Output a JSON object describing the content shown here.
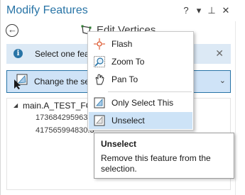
{
  "pane": {
    "title": "Modify Features",
    "controls": {
      "help": "?",
      "menu": "▾",
      "pin": "⊥",
      "close": "✕"
    }
  },
  "tool": {
    "label": "Edit Vertices"
  },
  "info": {
    "text": "Select one feat"
  },
  "change_selection": {
    "label": "Change the se"
  },
  "tree": {
    "root_label": "main.A_TEST_FC_3",
    "children": [
      "173684295963.",
      "417565994830.3"
    ]
  },
  "context_menu": {
    "items": [
      {
        "label": "Flash",
        "icon": "flash-icon"
      },
      {
        "label": "Zoom To",
        "icon": "zoom-to-icon"
      },
      {
        "label": "Pan To",
        "icon": "pan-to-icon"
      },
      {
        "label": "Only Select This",
        "icon": "select-this-icon"
      },
      {
        "label": "Unselect",
        "icon": "unselect-icon"
      }
    ],
    "active_item": "Unselect"
  },
  "tooltip": {
    "title": "Unselect",
    "body": "Remove this feature from the selection."
  },
  "colors": {
    "title_blue": "#2874a6",
    "info_bg": "#dce9f5",
    "highlight_bg": "#cde3f7"
  }
}
